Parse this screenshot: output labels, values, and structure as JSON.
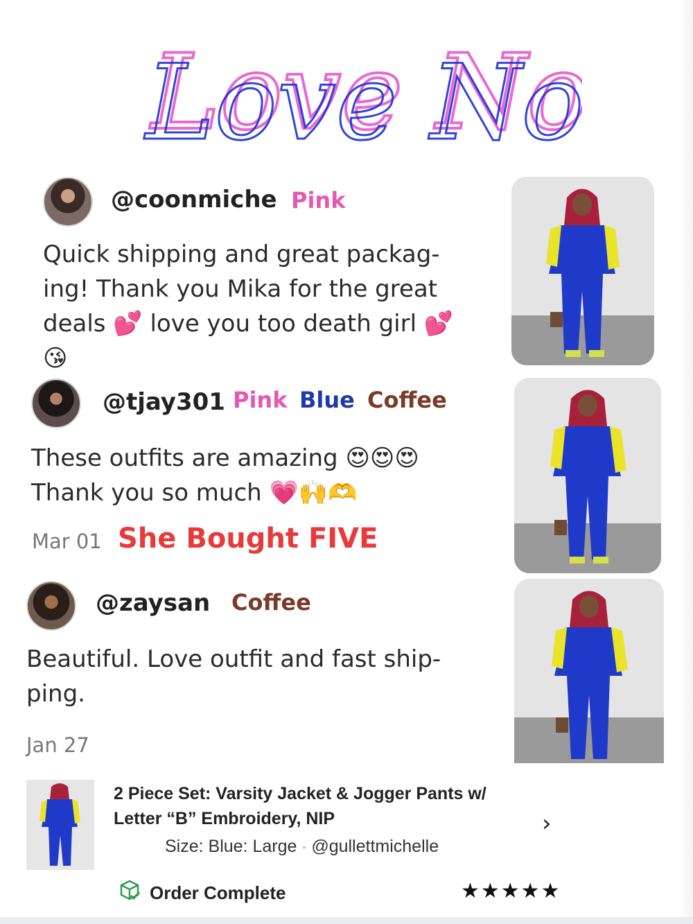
{
  "header": {
    "title": "Love Notes",
    "title_colors": {
      "primary": "#e86ad0",
      "secondary": "#1b2fd6"
    }
  },
  "reviews": [
    {
      "handle": "@coonmiche",
      "colors": [
        "Pink"
      ],
      "text": "Quick shipping and great packag-\ning! Thank you Mika for the great\ndeals 💕 love you too death girl 💕\n😘",
      "date": "",
      "highlight": ""
    },
    {
      "handle": "@tjay301",
      "colors": [
        "Pink",
        "Blue",
        "Coffee"
      ],
      "text": "These outfits are amazing 😍😍😍\nThank you so much 💗🙌🫶",
      "date": "Mar 01",
      "highlight": "She Bought FIVE"
    },
    {
      "handle": "@zaysan",
      "colors": [
        "Coffee"
      ],
      "text": "Beautiful. Love outfit and fast ship-\nping.",
      "date": "Jan 27",
      "highlight": ""
    }
  ],
  "product": {
    "title": "2 Piece Set: Varsity Jacket & Jogger Pants w/ Letter “B” Embroidery, NIP",
    "size": "Size: Blue: Large",
    "seller": "@gullettmichelle",
    "status": "Order Complete",
    "rating": 5,
    "stars": "★★★★★",
    "chevron": "›"
  },
  "palette": {
    "pink": "#e35ab0",
    "blue": "#1f3aa8",
    "coffee": "#7a3a2a",
    "highlight_red": "#e83a3a",
    "status_green": "#2f9b4f"
  }
}
